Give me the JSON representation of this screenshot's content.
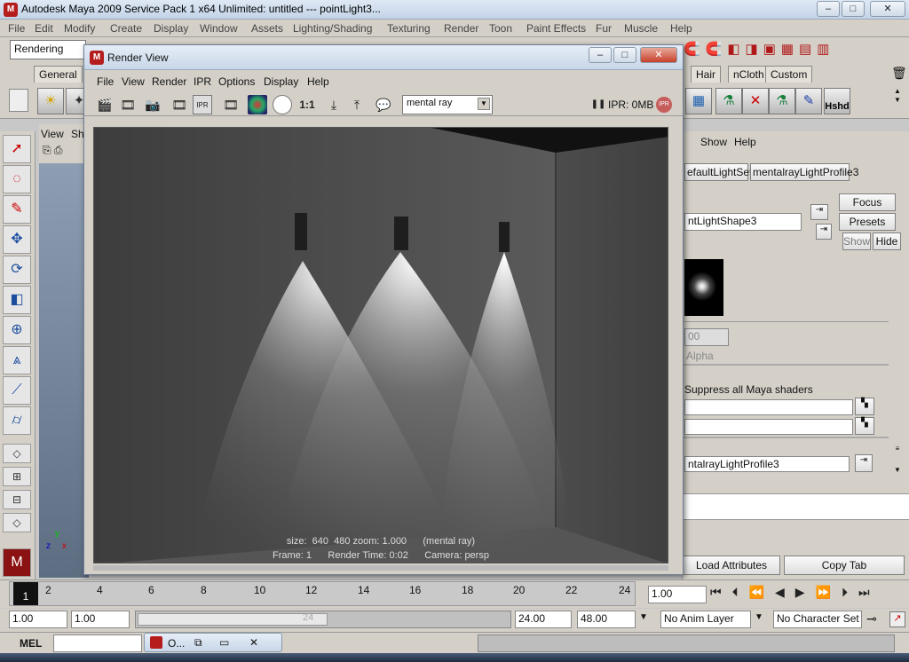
{
  "maya": {
    "title": "Autodesk Maya 2009 Service Pack 1 x64 Unlimited: untitled   ---   pointLight3...",
    "window_buttons": {
      "minimize": "–",
      "maximize": "□",
      "close": "✕"
    },
    "menu": [
      "File",
      "Edit",
      "Modify",
      "Create",
      "Display",
      "Window",
      "Assets",
      "Lighting/Shading",
      "Texturing",
      "Render",
      "Toon",
      "Paint Effects",
      "Fur",
      "Muscle",
      "Help"
    ],
    "menu_set": "Rendering",
    "shelf_tabs": [
      "General",
      "Hair",
      "nCloth",
      "Custom"
    ],
    "shelf_hshd_label": "Hshd"
  },
  "viewport": {
    "menu_view": "View",
    "menu_sh": "Sh"
  },
  "render_view": {
    "title": "Render View",
    "menu": [
      "File",
      "View",
      "Render",
      "IPR",
      "Options",
      "Display",
      "Help"
    ],
    "ratio_label": "1:1",
    "renderer": "mental ray",
    "ipr_status": "IPR: 0MB",
    "ipr_badge": "IPR",
    "info_line1": "size:  640  480 zoom: 1.000      (mental ray)",
    "info_line2": "Frame: 1      Render Time: 0:02      Camera: persp"
  },
  "attr_editor": {
    "menu_show": "Show",
    "menu_help": "Help",
    "tab1": "efaultLightSet",
    "tab2": "mentalrayLightProfile3",
    "shape_field": "ntLightShape3",
    "focus_btn": "Focus",
    "presets_btn": "Presets",
    "show_btn": "Show",
    "hide_btn": "Hide",
    "value_field": "00",
    "alpha_label": "Alpha",
    "suppress_label": "Suppress all Maya shaders",
    "profile_field": "ntalrayLightProfile3",
    "load_btn": "Load Attributes",
    "copy_btn": "Copy Tab"
  },
  "timeline": {
    "current_frame": "1",
    "ticks": [
      "2",
      "4",
      "6",
      "8",
      "10",
      "12",
      "14",
      "16",
      "18",
      "20",
      "22",
      "24"
    ],
    "current_time_field": "1.00",
    "start_time": "1.00",
    "playback_start": "1.00",
    "range_end_marker": "24",
    "playback_end": "24.00",
    "end_time": "48.00",
    "anim_layer": "No Anim Layer",
    "character_set": "No Character Set"
  },
  "command_line": {
    "label": "MEL",
    "mini_window_title": "O..."
  }
}
